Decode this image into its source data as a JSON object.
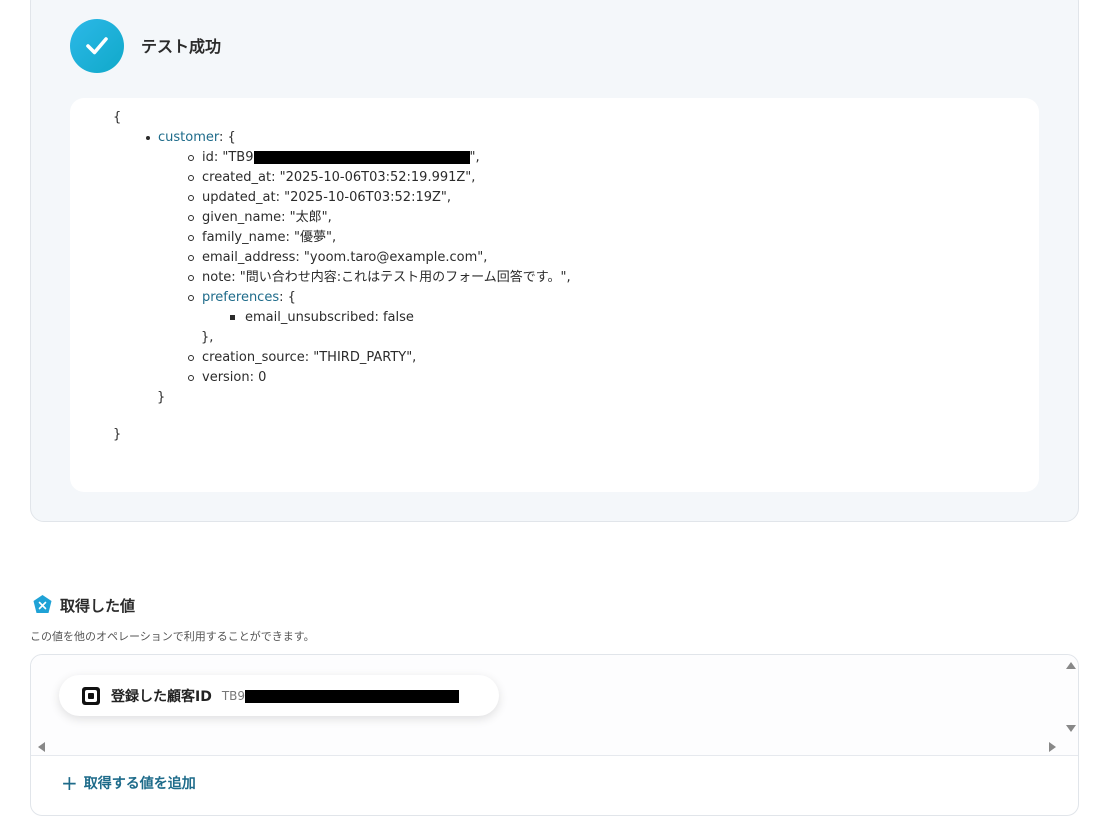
{
  "result": {
    "status_title": "テスト成功",
    "json_lines": {
      "open": "{",
      "customer_key": "customer",
      "customer_open": ": {",
      "id_prefix": "id: \"TB9",
      "id_suffix": "\",",
      "created_at": "created_at: \"2025-10-06T03:52:19.991Z\",",
      "updated_at": "updated_at: \"2025-10-06T03:52:19Z\",",
      "given_name": "given_name: \"太郎\",",
      "family_name": "family_name: \"優夢\",",
      "email_address": "email_address: \"yoom.taro@example.com\",",
      "note": "note: \"問い合わせ内容:これはテスト用のフォーム回答です。\",",
      "preferences_key": "preferences",
      "preferences_open": ": {",
      "email_unsubscribed": "email_unsubscribed: false",
      "preferences_close": "},",
      "creation_source": "creation_source: \"THIRD_PARTY\",",
      "version": "version: 0",
      "customer_close": "}",
      "close": "}"
    }
  },
  "acquired": {
    "title": "取得した値",
    "description": "この値を他のオペレーションで利用することができます。",
    "chip_label": "登録した顧客ID",
    "chip_value_prefix": "TB9",
    "add_label": "取得する値を追加"
  },
  "colors": {
    "accent": "#1e6b8a",
    "success": "#1fb0d8"
  }
}
